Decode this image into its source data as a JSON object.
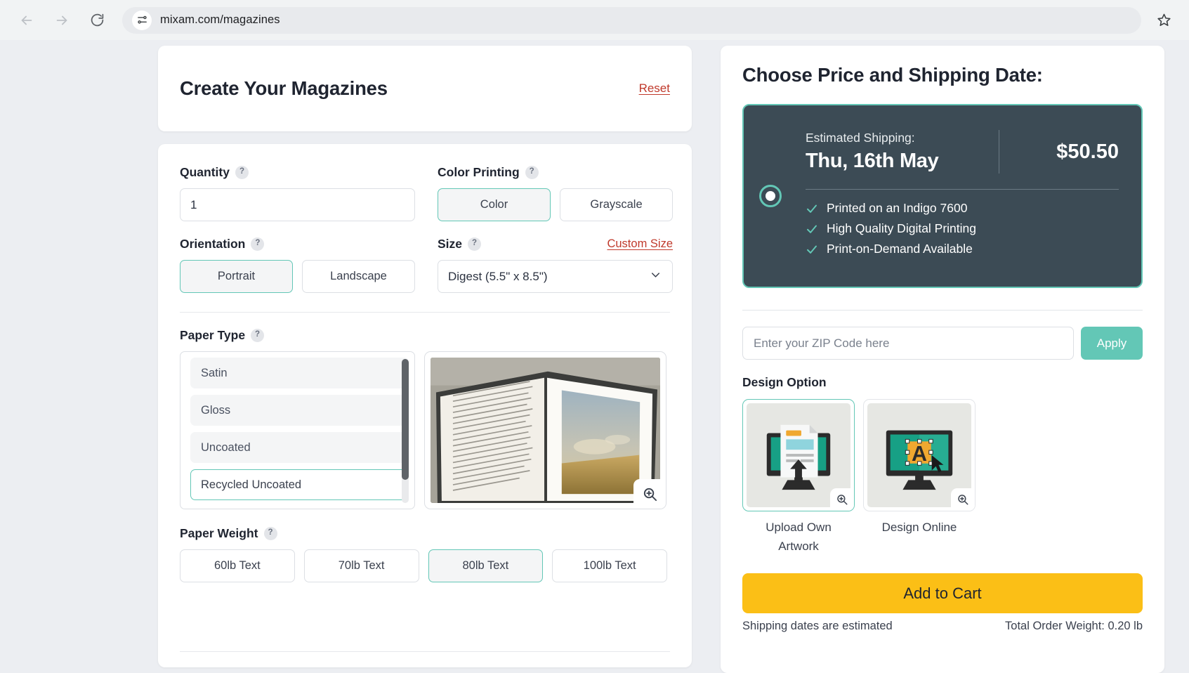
{
  "browser": {
    "back_icon": "arrow-left-icon",
    "forward_icon": "arrow-right-icon",
    "reload_icon": "reload-icon",
    "site_info_icon": "site-settings-icon",
    "url": "mixam.com/magazines",
    "bookmark_icon": "star-icon"
  },
  "left": {
    "title": "Create Your Magazines",
    "reset_label": "Reset",
    "quantity": {
      "label": "Quantity",
      "help": "?",
      "value": "1"
    },
    "color_printing": {
      "label": "Color Printing",
      "help": "?",
      "options": [
        "Color",
        "Grayscale"
      ],
      "selected": "Color"
    },
    "orientation": {
      "label": "Orientation",
      "help": "?",
      "options": [
        "Portrait",
        "Landscape"
      ],
      "selected": "Portrait"
    },
    "size": {
      "label": "Size",
      "help": "?",
      "custom_link": "Custom Size",
      "selected": "Digest (5.5\" x 8.5\")",
      "chevron_icon": "chevron-down-icon"
    },
    "paper_type": {
      "label": "Paper Type",
      "help": "?",
      "options": [
        "Satin",
        "Gloss",
        "Uncoated",
        "Recycled Uncoated"
      ],
      "selected": "Recycled Uncoated"
    },
    "preview": {
      "zoom_icon": "zoom-in-icon"
    },
    "paper_weight": {
      "label": "Paper Weight",
      "help": "?",
      "options": [
        "60lb Text",
        "70lb Text",
        "80lb Text",
        "100lb Text"
      ],
      "selected": "80lb Text"
    }
  },
  "right": {
    "title": "Choose Price and Shipping Date:",
    "price_option": {
      "shipping_label": "Estimated Shipping:",
      "shipping_date": "Thu, 16th May",
      "price": "$50.50",
      "selected": true,
      "features": [
        "Printed on an Indigo 7600",
        "High Quality Digital Printing",
        "Print-on-Demand Available"
      ]
    },
    "zip": {
      "placeholder": "Enter your ZIP Code here",
      "value": "",
      "apply_label": "Apply"
    },
    "design_option": {
      "label": "Design Option",
      "options": [
        {
          "caption": "Upload Own Artwork",
          "selected": true,
          "zoom_icon": "zoom-in-icon"
        },
        {
          "caption": "Design Online",
          "selected": false,
          "zoom_icon": "zoom-in-icon"
        }
      ]
    },
    "cart": {
      "label": "Add to Cart",
      "note": "Shipping dates are estimated",
      "weight": "Total Order Weight: 0.20 lb"
    }
  },
  "colors": {
    "accent_teal": "#63c7b6",
    "dark_card": "#3c4b55",
    "cart_yellow": "#fbbf16",
    "link_red": "#c0392b"
  }
}
